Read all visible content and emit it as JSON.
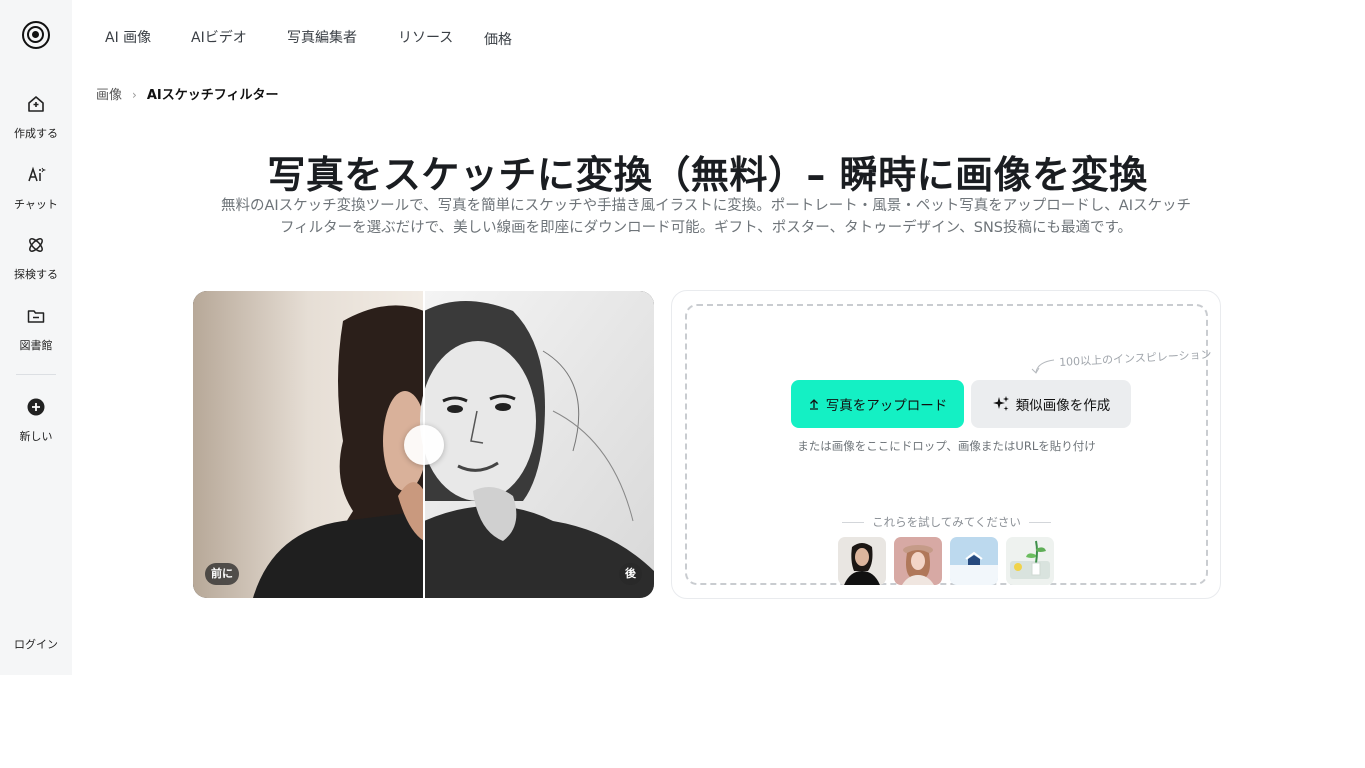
{
  "sidebar": {
    "items": [
      {
        "label": "作成する",
        "icon": "create-home-icon"
      },
      {
        "label": "チャット",
        "icon": "ai-chat-icon"
      },
      {
        "label": "探検する",
        "icon": "explore-atom-icon"
      },
      {
        "label": "図書館",
        "icon": "folder-icon"
      }
    ],
    "new_label": "新しい",
    "login_label": "ログイン"
  },
  "nav": {
    "items": [
      "AI 画像",
      "AIビデオ",
      "写真編集者",
      "リソース",
      "価格"
    ]
  },
  "breadcrumb": {
    "home": "画像",
    "separator": "›",
    "current": "AIスケッチフィルター"
  },
  "hero": {
    "title": "写真をスケッチに変換（無料）– 瞬時に画像を変換",
    "description": "無料のAIスケッチ変換ツールで、写真を簡単にスケッチや手描き風イラストに変換。ポートレート・風景・ペット写真をアップロードし、AIスケッチフィルターを選ぶだけで、美しい線画を即座にダウンロード可能。ギフト、ポスター、タトゥーデザイン、SNS投稿にも最適です。"
  },
  "compare": {
    "before_label": "前に",
    "after_label": "後"
  },
  "upload": {
    "inspiration_note": "100以上のインスピレーション",
    "upload_button": "写真をアップロード",
    "similar_button": "類似画像を作成",
    "drop_hint": "または画像をここにドロップ、画像またはURLを貼り付け",
    "try_label": "これらを試してみてください",
    "samples": [
      "sample-portrait-dark",
      "sample-portrait-hat",
      "sample-snow-house",
      "sample-plants"
    ]
  },
  "colors": {
    "accent": "#14f0c4",
    "sidebar_bg": "#f5f6f7",
    "title": "#1a1d21",
    "muted": "#6e7479"
  }
}
